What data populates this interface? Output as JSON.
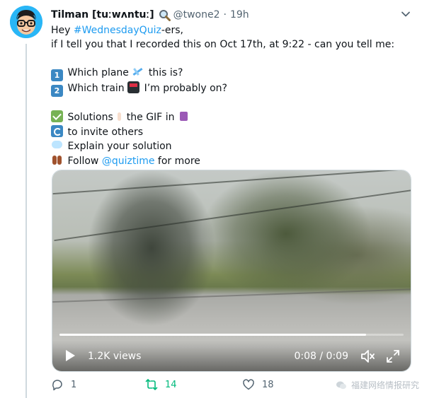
{
  "tweet": {
    "display_name": "Tilman [tuːwʌntuː]",
    "handle": "@twone2",
    "separator": "·",
    "time": "19h",
    "lines": {
      "l1_a": "Hey ",
      "l1_hashtag": "#WednesdayQuiz",
      "l1_b": "-ers,",
      "l2": "if I tell you that I recorded this on Oct 17th, at 9:22 - can you tell me:",
      "q1_num": "1",
      "q1_a": "Which plane ",
      "q1_b": " this is?",
      "q2_num": "2",
      "q2_a": "Which train ",
      "q2_b": " I’m probably on?",
      "s1_a": "Solutions",
      "s1_b": "the GIF in",
      "s2": "to invite others",
      "s3": "Explain your solution",
      "s4_a": "Follow ",
      "s4_mention": "@quiztime",
      "s4_b": " for more"
    },
    "emoji_icons": [
      "search-icon",
      "plane-icon",
      "train-icon",
      "check-icon",
      "pointing-hand-icon",
      "spool-icon",
      "cycle-icon",
      "speech-bubble-icon",
      "footprints-icon"
    ]
  },
  "video": {
    "views": "1.2K views",
    "time": "0:08 / 0:09",
    "progress": 0.89
  },
  "actions": {
    "reply_count": "1",
    "retweet_count": "14",
    "like_count": "18"
  },
  "watermark": {
    "text": "福建网络情报研究"
  },
  "colors": {
    "link": "#1d9bf0",
    "retweet": "#00ba7c",
    "muted": "#536471",
    "text": "#0f1419"
  }
}
